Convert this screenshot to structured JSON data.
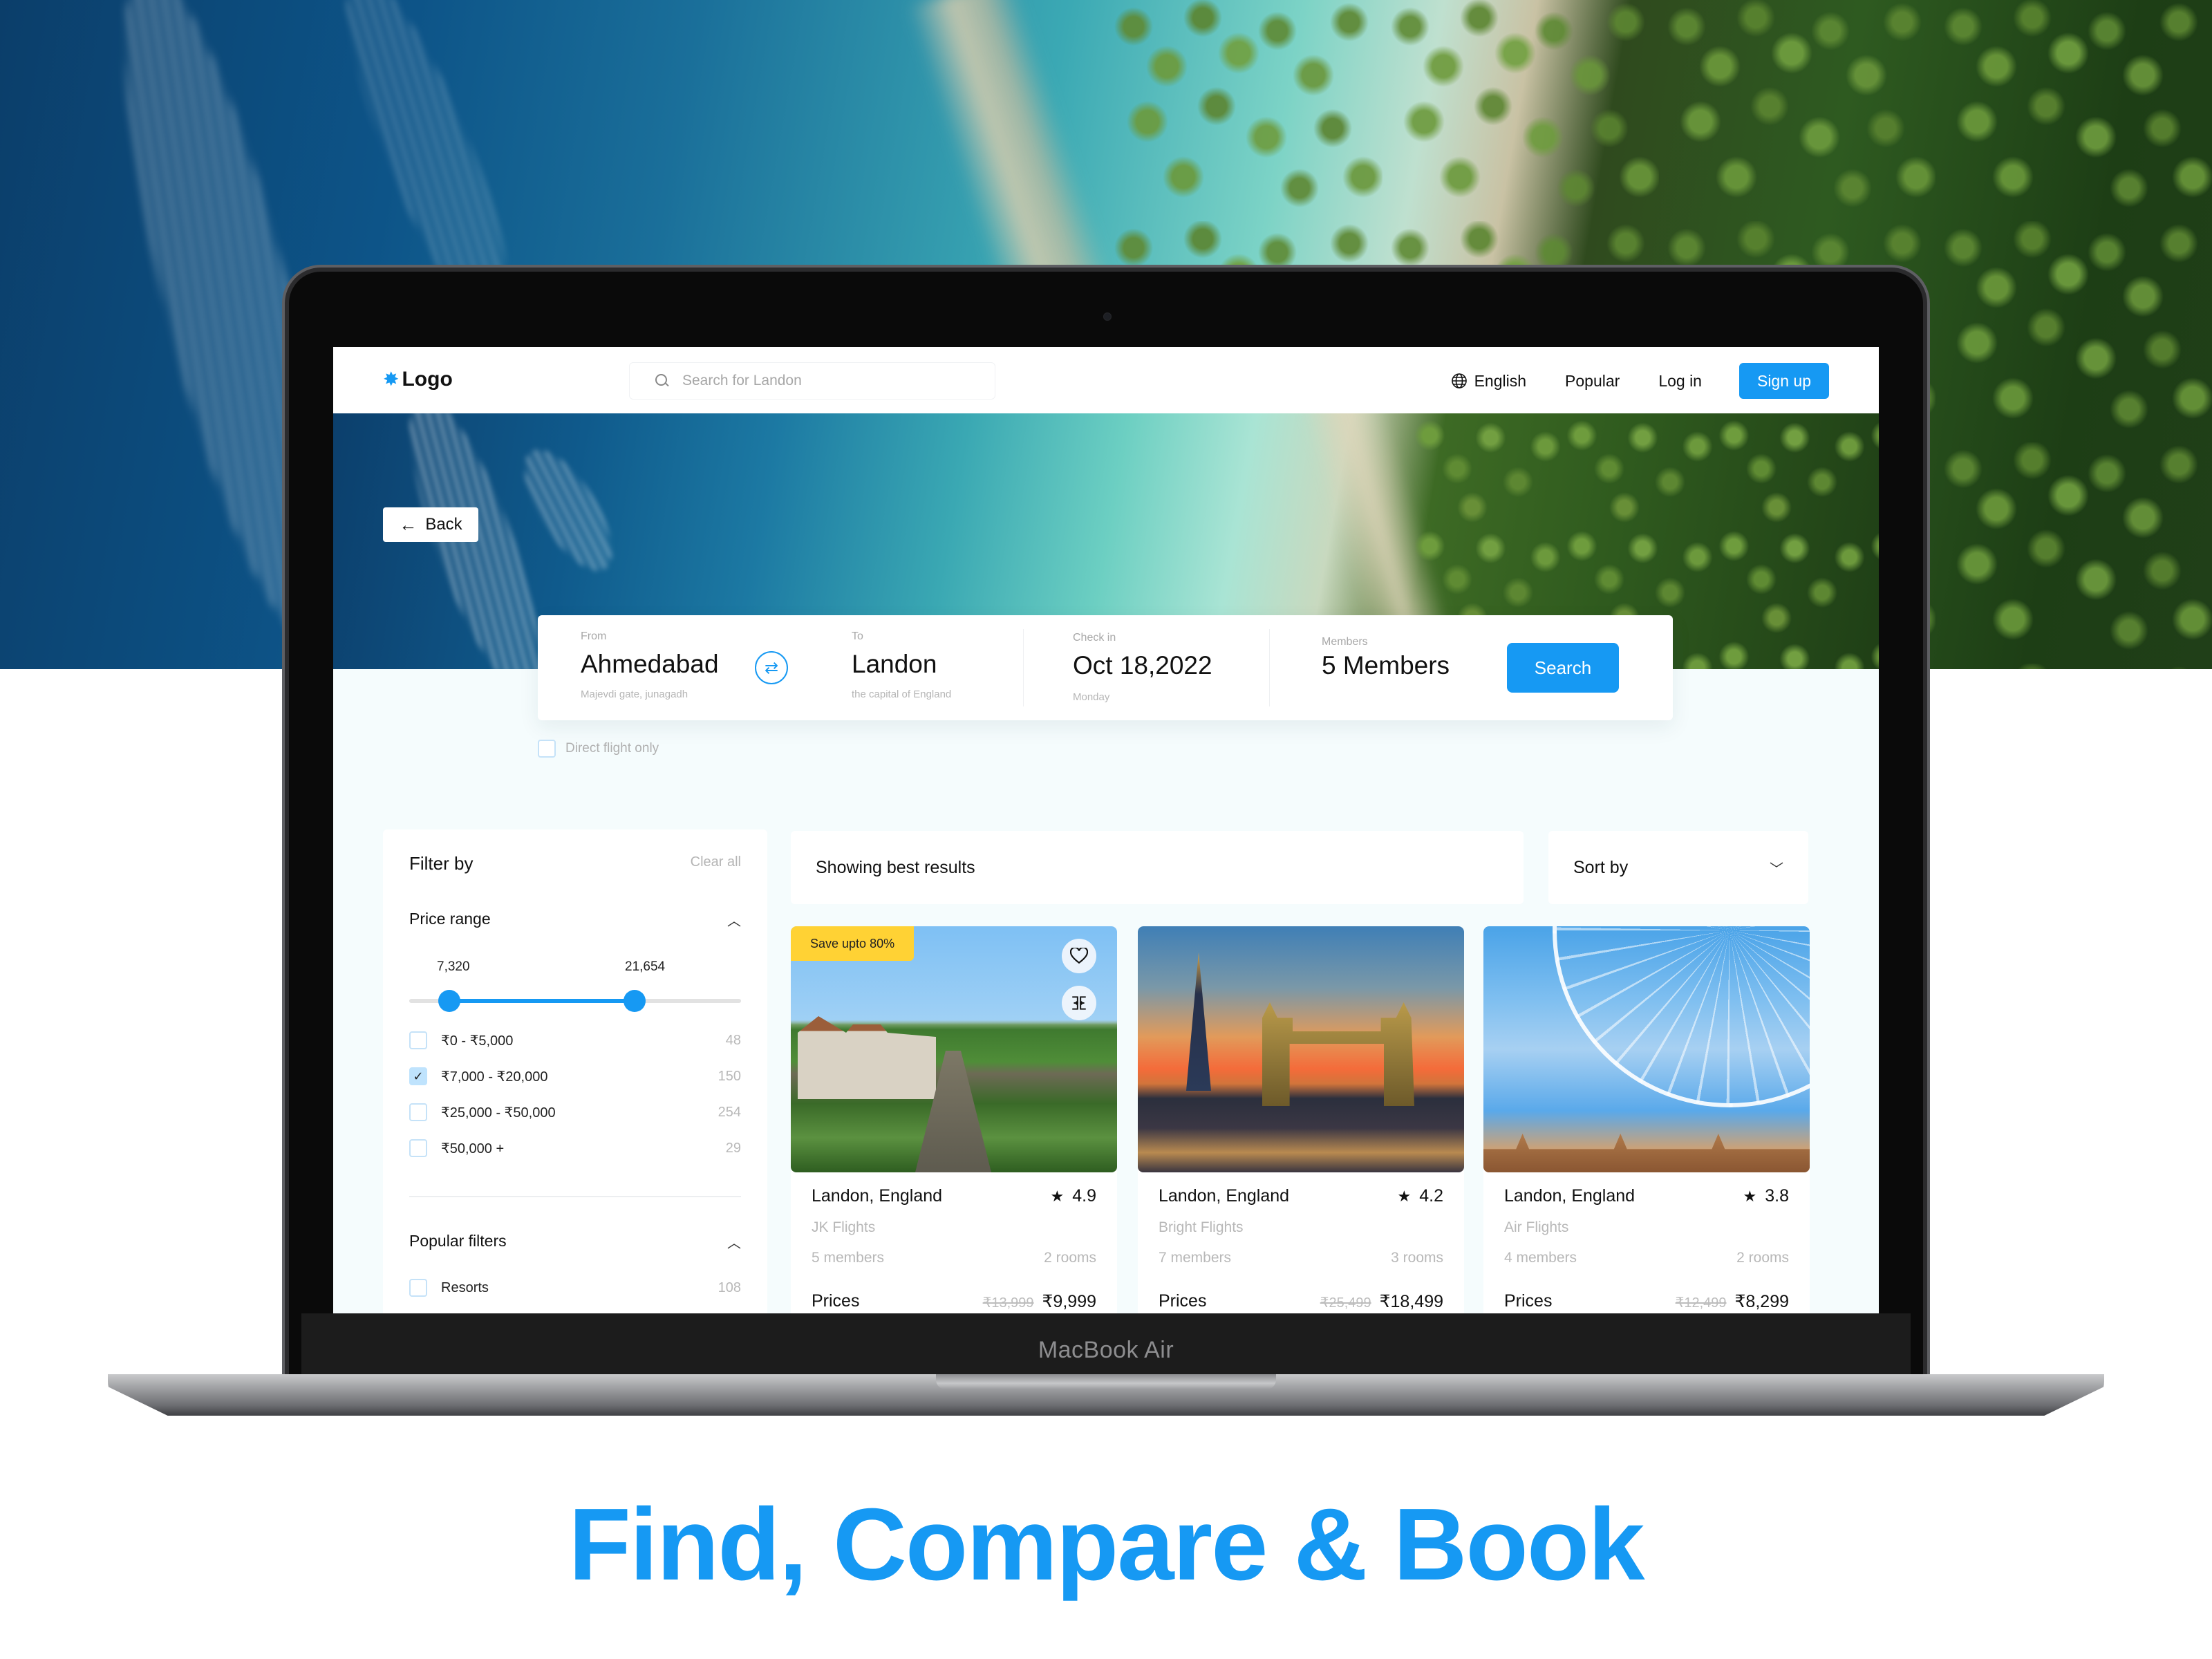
{
  "device": {
    "label": "MacBook Air"
  },
  "navbar": {
    "logo": "Logo",
    "logo_icon": "star-burst-icon",
    "search_placeholder": "Search for Landon",
    "language": "English",
    "popular": "Popular",
    "login": "Log in",
    "signup": "Sign up"
  },
  "hero": {
    "back_label": "Back"
  },
  "booking": {
    "from": {
      "label": "From",
      "value": "Ahmedabad",
      "sub": "Majevdi gate, junagadh"
    },
    "to": {
      "label": "To",
      "value": "Landon",
      "sub": "the capital of England"
    },
    "checkin": {
      "label": "Check in",
      "value": "Oct 18,2022",
      "sub": "Monday"
    },
    "members": {
      "label": "Members",
      "value": "5 Members"
    },
    "search_label": "Search",
    "direct_flight_label": "Direct flight only",
    "direct_flight_checked": false
  },
  "filters": {
    "title": "Filter by",
    "clear_all": "Clear all",
    "price_range": {
      "title": "Price range",
      "min_value": 7320,
      "max_value": 21654,
      "min_label": "7,320",
      "max_label": "21,654",
      "slider_min_fraction": 0.12,
      "slider_max_fraction": 0.68,
      "options": [
        {
          "label": "₹0 - ₹5,000",
          "count": "48",
          "checked": false
        },
        {
          "label": "₹7,000 - ₹20,000",
          "count": "150",
          "checked": true
        },
        {
          "label": "₹25,000 - ₹50,000",
          "count": "254",
          "checked": false
        },
        {
          "label": "₹50,000 +",
          "count": "29",
          "checked": false
        }
      ]
    },
    "popular_filters": {
      "title": "Popular filters",
      "options": [
        {
          "label": "Resorts",
          "count": "108",
          "checked": false
        }
      ]
    }
  },
  "results": {
    "heading": "Showing best results",
    "sort_label": "Sort by",
    "cards": [
      {
        "badge": "Save upto 80%",
        "title": "Landon, England",
        "rating": "4.9",
        "airline": "JK Flights",
        "members": "5 members",
        "rooms": "2 rooms",
        "prices_label": "Prices",
        "old_price": "₹13,999",
        "new_price": "₹9,999"
      },
      {
        "badge": "",
        "title": "Landon, England",
        "rating": "4.2",
        "airline": "Bright Flights",
        "members": "7 members",
        "rooms": "3 rooms",
        "prices_label": "Prices",
        "old_price": "₹25,499",
        "new_price": "₹18,499"
      },
      {
        "badge": "",
        "title": "Landon, England",
        "rating": "3.8",
        "airline": "Air Flights",
        "members": "4 members",
        "rooms": "2 rooms",
        "prices_label": "Prices",
        "old_price": "₹12,499",
        "new_price": "₹8,299"
      }
    ]
  },
  "tagline": "Find, Compare & Book",
  "colors": {
    "accent": "#1699f3",
    "badge": "#ffd234",
    "checkbox_checked": "#bfe3fd"
  }
}
